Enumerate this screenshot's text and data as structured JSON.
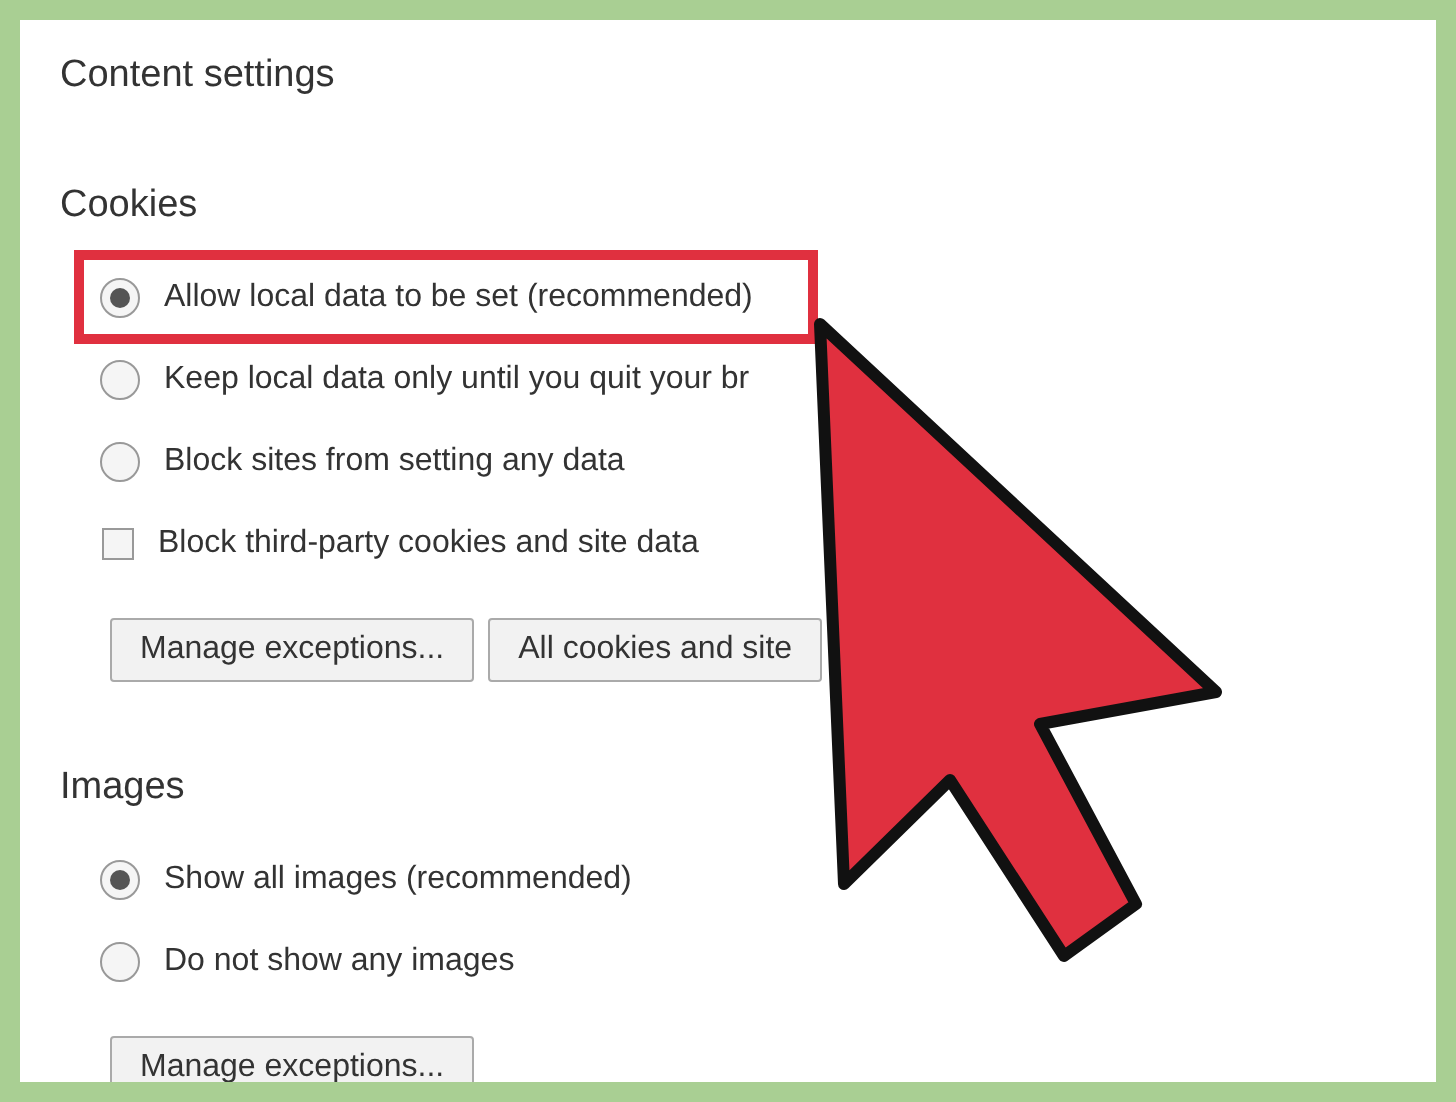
{
  "title": "Content settings",
  "sections": [
    {
      "heading": "Cookies",
      "items": [
        {
          "kind": "radio",
          "label": "Allow local data to be set (recommended)",
          "selected": true,
          "highlighted": true
        },
        {
          "kind": "radio",
          "label": "Keep local data only until you quit your br",
          "selected": false,
          "highlighted": false
        },
        {
          "kind": "radio",
          "label": "Block sites from setting any data",
          "selected": false,
          "highlighted": false
        },
        {
          "kind": "checkbox",
          "label": "Block third-party cookies and site data",
          "checked": false,
          "highlighted": false
        }
      ],
      "buttons": [
        "Manage exceptions...",
        "All cookies and site"
      ]
    },
    {
      "heading": "Images",
      "items": [
        {
          "kind": "radio",
          "label": "Show all images (recommended)",
          "selected": true,
          "highlighted": false
        },
        {
          "kind": "radio",
          "label": "Do not show any images",
          "selected": false,
          "highlighted": false
        }
      ],
      "buttons": [
        "Manage exceptions..."
      ]
    }
  ]
}
